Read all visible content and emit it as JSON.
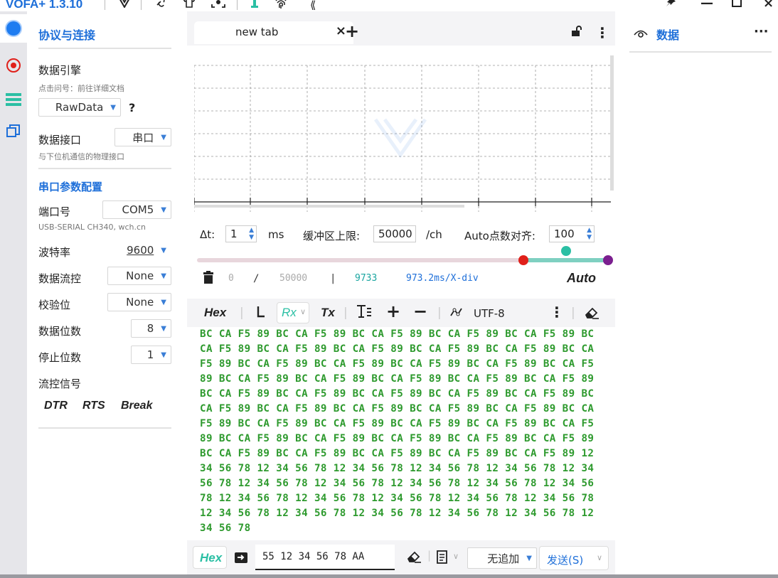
{
  "titlebar": {
    "app_title": "VOFA+ 1.3.10",
    "icons": [
      "vofa-logo-icon",
      "link-icon",
      "tshirt-icon",
      "screen-capture-icon",
      "info-icon",
      "fingerprint-icon",
      "collapse-icon",
      "pin-icon",
      "minimize-icon",
      "maximize-icon",
      "close-icon"
    ]
  },
  "config": {
    "section1_title": "协议与连接",
    "engine_label": "数据引擎",
    "engine_hint": "点击问号：前往详细文档",
    "engine_value": "RawData",
    "engine_help": "?",
    "interface_label": "数据接口",
    "interface_value": "串口",
    "interface_hint": "与下位机通信的物理接口",
    "section2_title": "串口参数配置",
    "port_label": "端口号",
    "port_value": "COM5",
    "port_hint": "USB-SERIAL CH340, wch.cn",
    "baud_label": "波特率",
    "baud_value": "9600",
    "flow_label": "数据流控",
    "flow_value": "None",
    "parity_label": "校验位",
    "parity_value": "None",
    "databits_label": "数据位数",
    "databits_value": "8",
    "stopbits_label": "停止位数",
    "stopbits_value": "1",
    "flowsig_label": "流控信号",
    "dtr": "DTR",
    "rts": "RTS",
    "break": "Break"
  },
  "tab": {
    "label": "new tab",
    "close": "×",
    "add": "+",
    "menu": "⋮"
  },
  "controls": {
    "dt_label": "Δt:",
    "dt_value": "1",
    "dt_unit": "ms",
    "buffer_label": "缓冲区上限:",
    "buffer_value": "50000",
    "buffer_unit": "/ch",
    "auto_align_label": "Auto点数对齐:",
    "auto_align_value": "100"
  },
  "stats": {
    "count": "0",
    "sep1": "/",
    "total": "50000",
    "sep2": "|",
    "points": "9733",
    "xdiv": "973.2ms/X-div",
    "auto": "Auto"
  },
  "rxbar": {
    "hex": "Hex",
    "rx": "Rx",
    "tx": "Tx",
    "encoding": "UTF-8"
  },
  "hex_lines": [
    "BC CA F5 89 BC CA F5 89 BC CA F5 89 BC CA F5 89 BC CA F5 89 BC",
    "CA F5 89 BC CA F5 89 BC CA F5 89 BC CA F5 89 BC CA F5 89 BC CA",
    "F5 89 BC CA F5 89 BC CA F5 89 BC CA F5 89 BC CA F5 89 BC CA F5",
    "89 BC CA F5 89 BC CA F5 89 BC CA F5 89 BC CA F5 89 BC CA F5 89",
    "BC CA F5 89 BC CA F5 89 BC CA F5 89 BC CA F5 89 BC CA F5 89 BC",
    "CA F5 89 BC CA F5 89 BC CA F5 89 BC CA F5 89 BC CA F5 89 BC CA",
    "F5 89 BC CA F5 89 BC CA F5 89 BC CA F5 89 BC CA F5 89 BC CA F5",
    "89 BC CA F5 89 BC CA F5 89 BC CA F5 89 BC CA F5 89 BC CA F5 89",
    "BC CA F5 89 BC CA F5 89 BC CA F5 89 BC CA F5 89 BC CA F5 89 12",
    "34 56 78 12 34 56 78 12 34 56 78 12 34 56 78 12 34 56 78 12 34",
    "56 78 12 34 56 78 12 34 56 78 12 34 56 78 12 34 56 78 12 34 56",
    "78 12 34 56 78 12 34 56 78 12 34 56 78 12 34 56 78 12 34 56 78",
    "12 34 56 78 12 34 56 78 12 34 56 78 12 34 56 78 12 34 56 78 12",
    "34 56 78"
  ],
  "sendbar": {
    "hex": "Hex",
    "input_value": "55 12 34 56 78 AA",
    "append_value": "无追加",
    "send_label": "发送(S)"
  },
  "right": {
    "title": "数据",
    "menu": "···"
  },
  "colors": {
    "accent": "#1e6fd9",
    "hex_text": "#2e9a2e",
    "teal": "#2bbfa4",
    "red": "#e0201a",
    "purple": "#7b1f8f"
  }
}
